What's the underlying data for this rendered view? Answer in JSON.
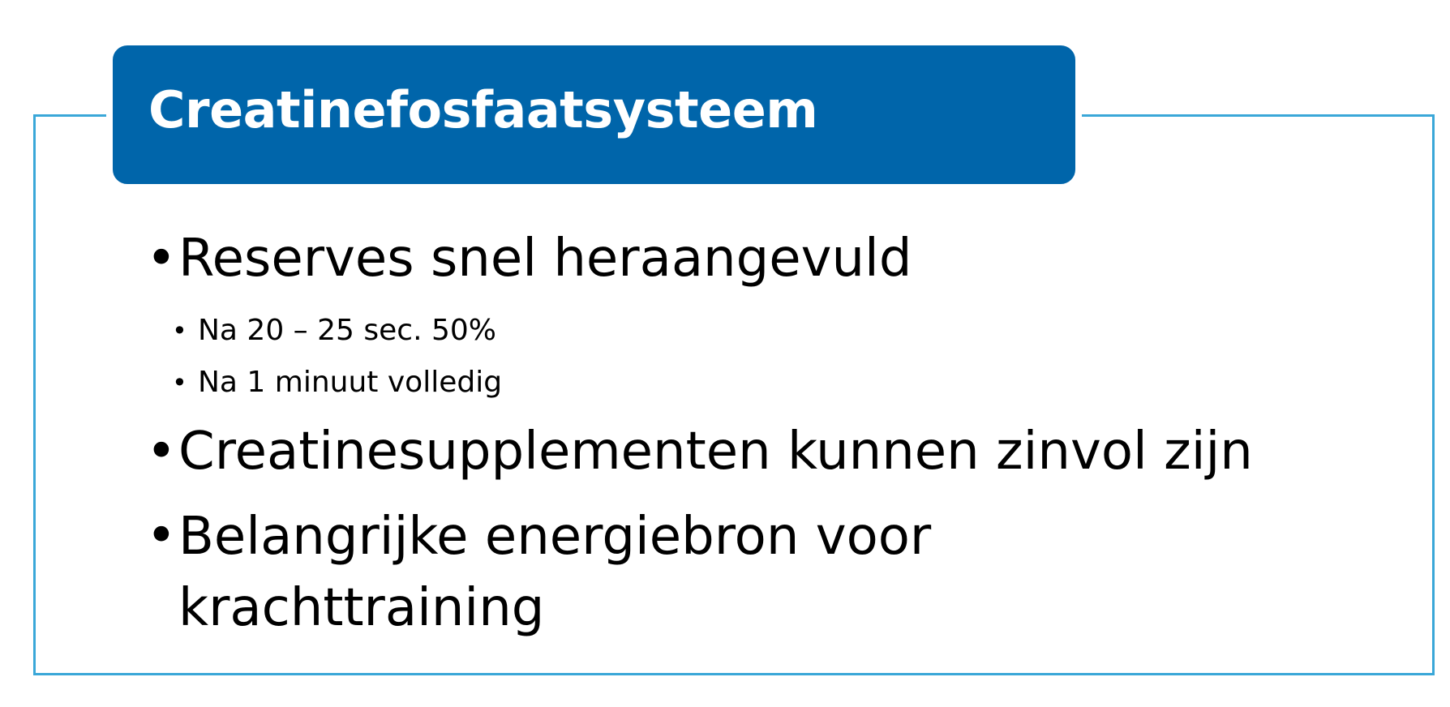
{
  "title": "Creatinefosfaatsysteem",
  "bullets": [
    {
      "text": "Reserves snel heraangevuld",
      "sub": [
        "Na 20 – 25 sec. 50%",
        "Na 1 minuut volledig"
      ]
    },
    {
      "text": "Creatinesupplementen kunnen zinvol zijn"
    },
    {
      "text": "Belangrijke energiebron voor krachttraining"
    }
  ],
  "bullet_glyph": "•",
  "colors": {
    "banner": "#0065aa",
    "frame": "#3aa7d8",
    "title_text": "#ffffff",
    "body_text": "#000000"
  }
}
